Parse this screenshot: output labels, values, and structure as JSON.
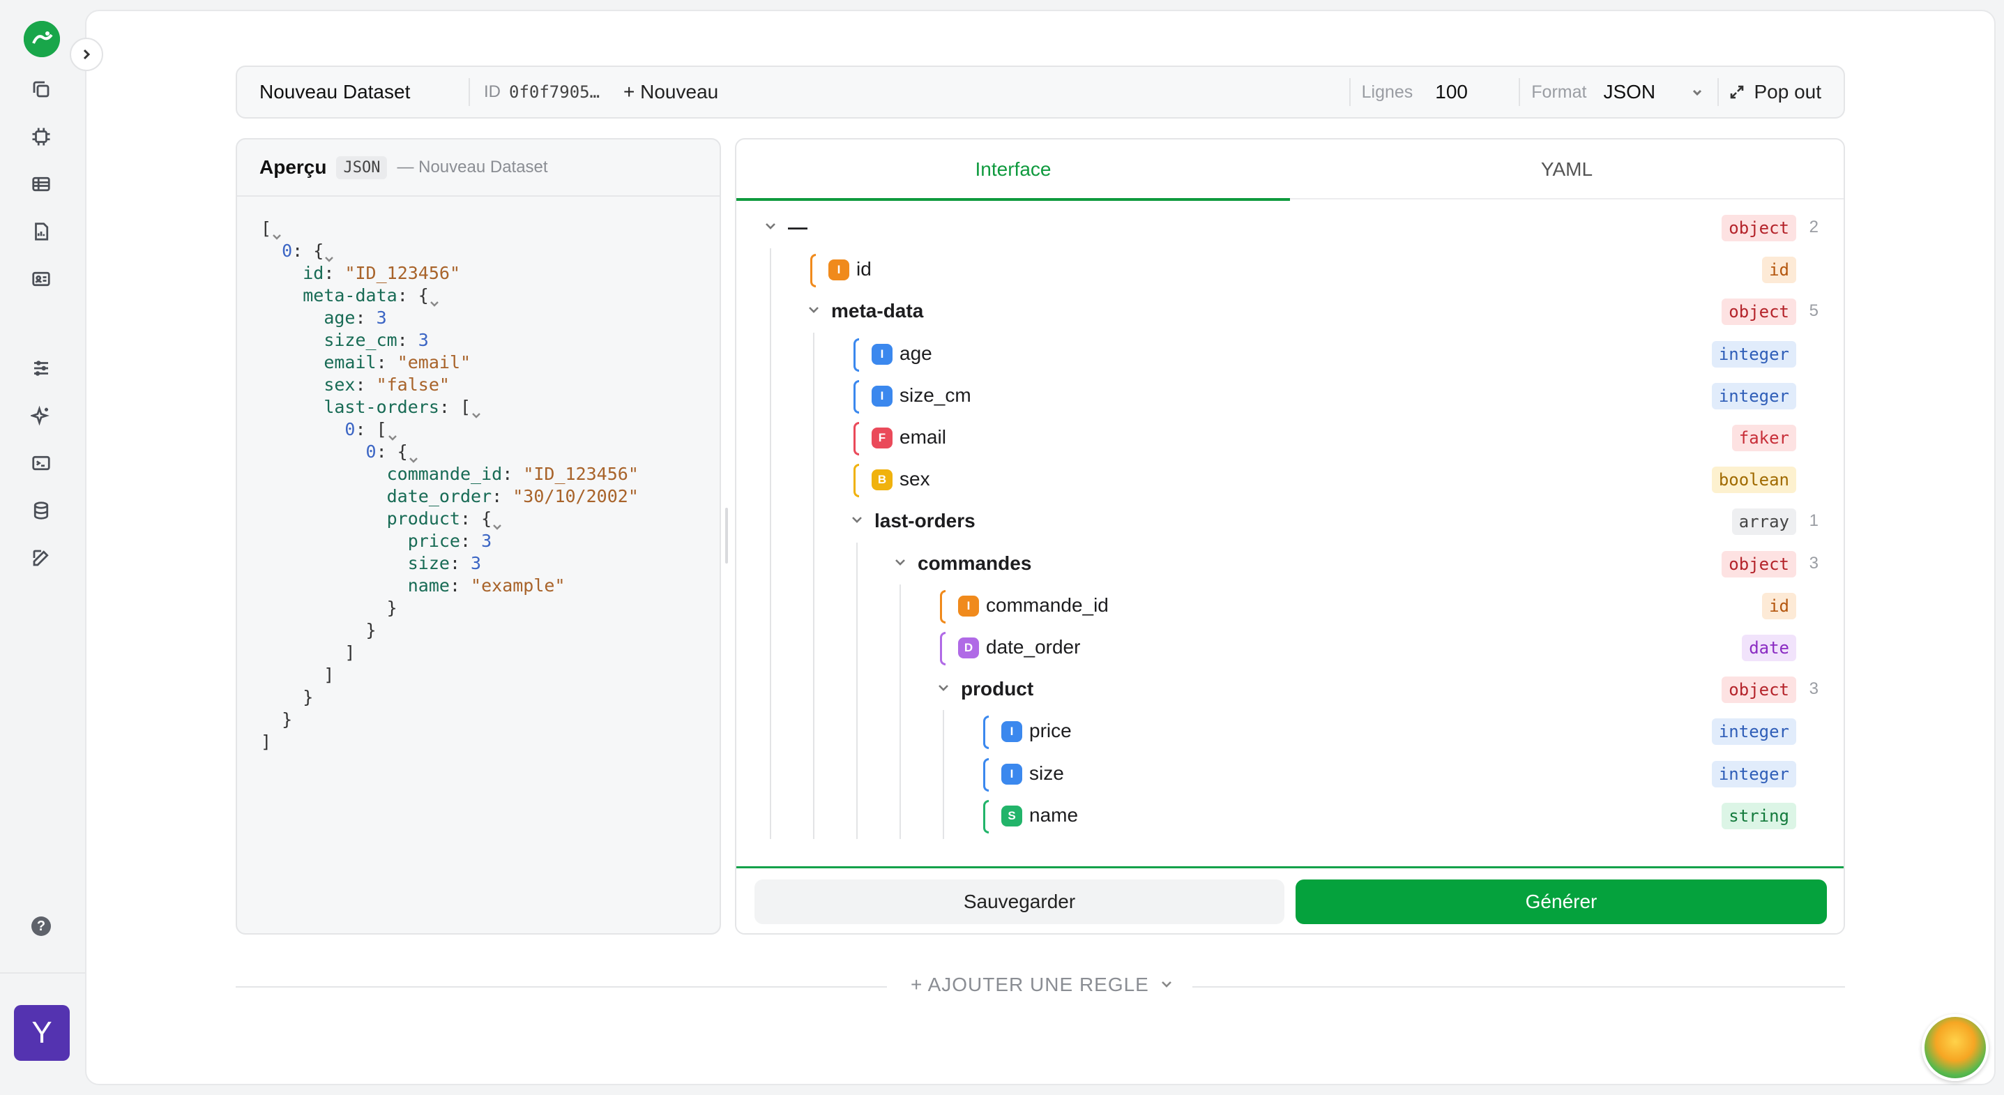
{
  "toolbar": {
    "dataset_name": "Nouveau Dataset",
    "id_label": "ID",
    "id_value": "0f0f7905…",
    "new_label": "+ Nouveau",
    "rows_label": "Lignes",
    "rows_value": "100",
    "format_label": "Format",
    "format_value": "JSON",
    "popout_label": "Pop out"
  },
  "preview": {
    "title": "Aperçu",
    "format_badge": "JSON",
    "subtitle": "— Nouveau Dataset",
    "lines": [
      "[",
      "  0: {",
      "    id: \"ID_123456\"",
      "    meta-data: {",
      "      age: 3",
      "      size_cm: 3",
      "      email: \"email\"",
      "      sex: \"false\"",
      "      last-orders: [",
      "        0: [",
      "          0: {",
      "            commande_id: \"ID_123456\"",
      "            date_order: \"30/10/2002\"",
      "            product: {",
      "              price: 3",
      "              size: 3",
      "              name: \"example\"",
      "            }",
      "          }",
      "        ]",
      "      ]",
      "    }",
      "  }",
      "]"
    ]
  },
  "editor": {
    "tabs": [
      "Interface",
      "YAML"
    ],
    "active_tab": "Interface",
    "tree": [
      {
        "label": "—",
        "type": "object",
        "count": "2",
        "depth": 0,
        "kind": "group"
      },
      {
        "label": "id",
        "type": "id",
        "icon": "I",
        "depth": 1,
        "kind": "field"
      },
      {
        "label": "meta-data",
        "type": "object",
        "count": "5",
        "depth": 1,
        "kind": "group"
      },
      {
        "label": "age",
        "type": "integer",
        "icon": "I",
        "depth": 2,
        "kind": "field"
      },
      {
        "label": "size_cm",
        "type": "integer",
        "icon": "I",
        "depth": 2,
        "kind": "field"
      },
      {
        "label": "email",
        "type": "faker",
        "icon": "F",
        "depth": 2,
        "kind": "field"
      },
      {
        "label": "sex",
        "type": "boolean",
        "icon": "B",
        "depth": 2,
        "kind": "field"
      },
      {
        "label": "last-orders",
        "type": "array",
        "count": "1",
        "depth": 2,
        "kind": "group"
      },
      {
        "label": "commandes",
        "type": "object",
        "count": "3",
        "depth": 3,
        "kind": "group"
      },
      {
        "label": "commande_id",
        "type": "id",
        "icon": "I",
        "depth": 4,
        "kind": "field"
      },
      {
        "label": "date_order",
        "type": "date",
        "icon": "D",
        "depth": 4,
        "kind": "field"
      },
      {
        "label": "product",
        "type": "object",
        "count": "3",
        "depth": 4,
        "kind": "group"
      },
      {
        "label": "price",
        "type": "integer",
        "icon": "I",
        "depth": 5,
        "kind": "field"
      },
      {
        "label": "size",
        "type": "integer",
        "icon": "I",
        "depth": 5,
        "kind": "field"
      },
      {
        "label": "name",
        "type": "string",
        "icon": "S",
        "depth": 5,
        "kind": "field"
      }
    ],
    "save_label": "Sauvegarder",
    "generate_label": "Générer"
  },
  "add_rule_label": "+ AJOUTER UNE REGLE",
  "user": {
    "avatar_initial": "Y"
  },
  "colors": {
    "accent": "#05a23d",
    "avatar": "#5433b0"
  }
}
